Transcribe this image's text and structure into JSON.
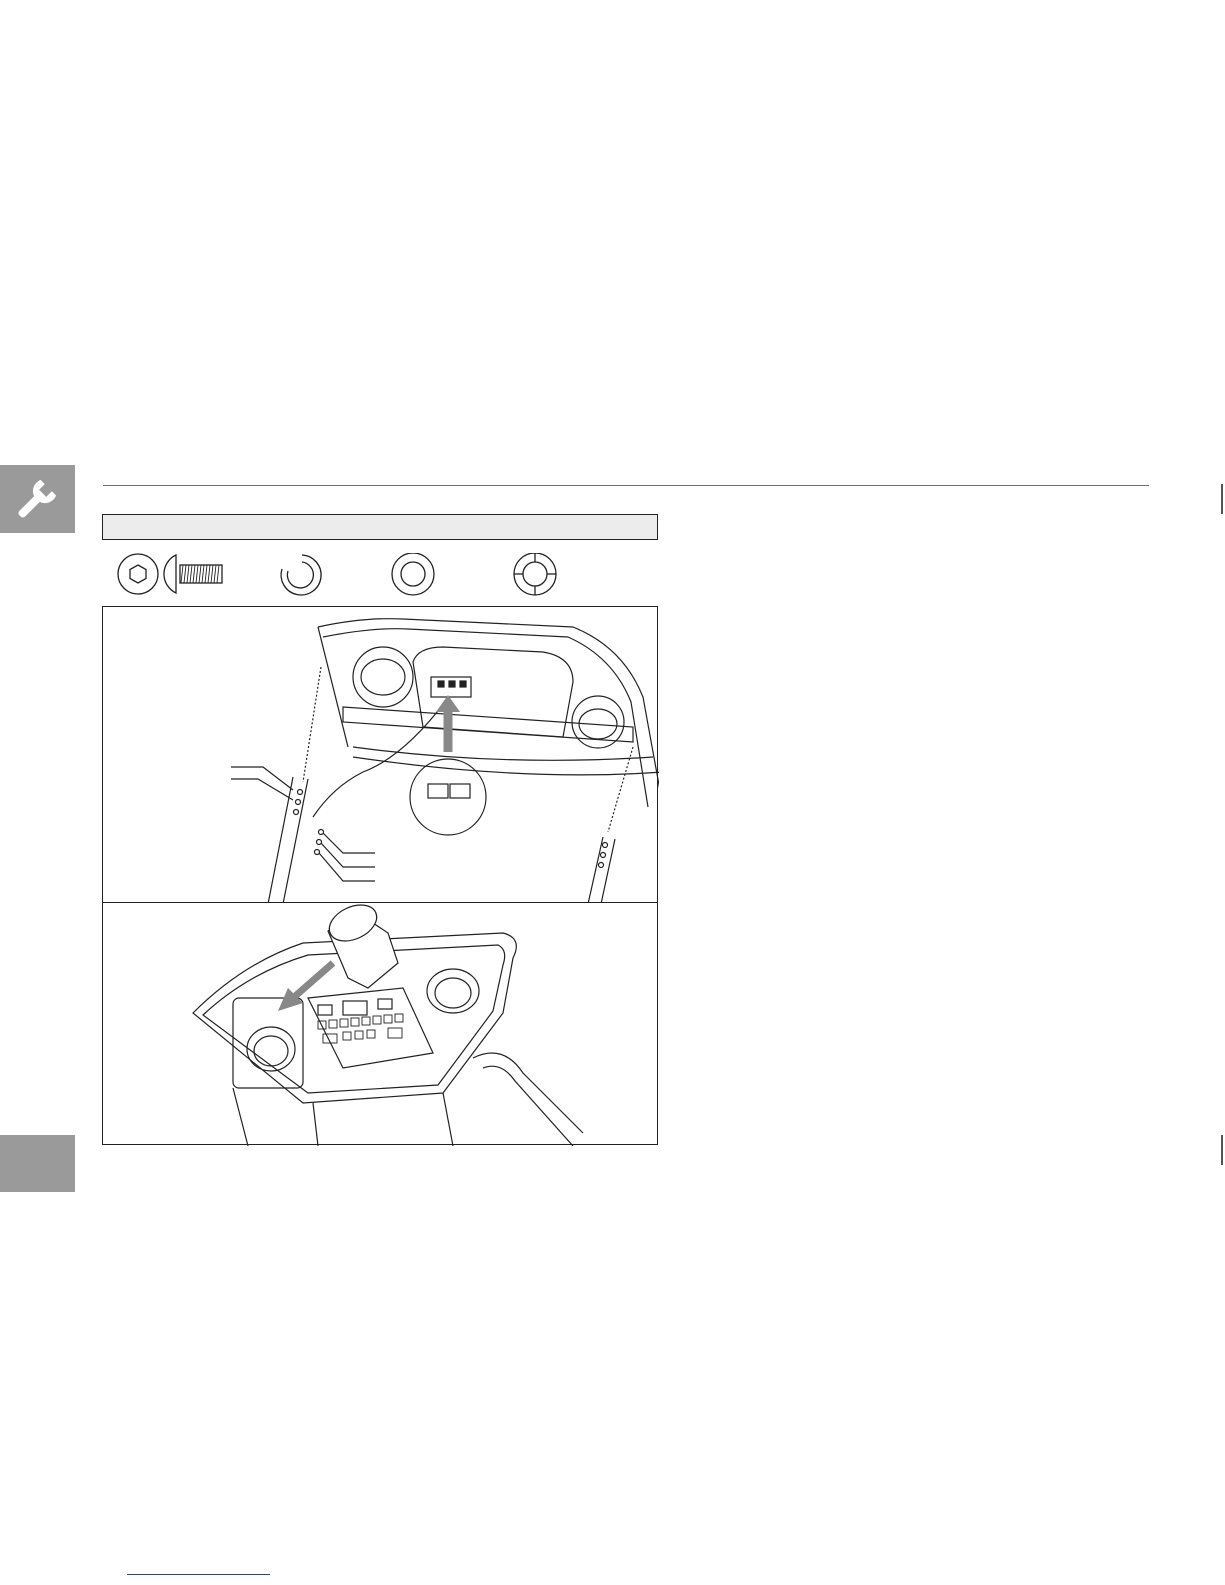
{
  "page": {
    "side_tab_icon": "wrench-icon",
    "step_header": {
      "text": ""
    },
    "parts": [
      {
        "name": "button-head-bolt",
        "icon": "hex-bolt-icon"
      },
      {
        "name": "split-washer",
        "icon": "split-washer-icon"
      },
      {
        "name": "flat-washer",
        "icon": "flat-washer-icon"
      },
      {
        "name": "star-washer",
        "icon": "star-washer-icon"
      }
    ],
    "figures": [
      {
        "id": "console-underside-cable-connection",
        "icon": "treadmill-console-underside-illustration"
      },
      {
        "id": "console-mounting-with-arrow",
        "icon": "treadmill-console-top-illustration"
      }
    ],
    "colors": {
      "tab_gray": "#9a9a9a",
      "header_gray": "#ececec",
      "line": "#222222",
      "link_underline": "#2c3ea8"
    }
  }
}
